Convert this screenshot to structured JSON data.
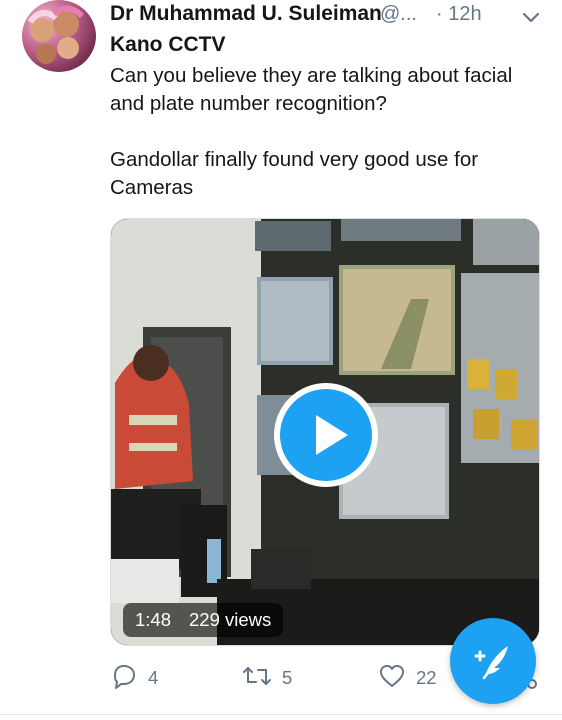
{
  "author": {
    "display_name": "Dr Muhammad U. Suleiman",
    "handle": "@...",
    "timestamp": "· 12h"
  },
  "tweet": {
    "title": "Kano CCTV",
    "lines": [
      "Can you believe they are talking about facial",
      "and plate number recognition?",
      "",
      "Gandollar finally found very good use for",
      "Cameras"
    ]
  },
  "video": {
    "duration": "1:48",
    "views": "229 views",
    "play_icon": "play-icon"
  },
  "actions": {
    "reply_count": "4",
    "retweet_count": "5",
    "like_count": "22"
  },
  "icons": {
    "reply": "reply-icon",
    "retweet": "retweet-icon",
    "like": "heart-icon",
    "share": "share-icon",
    "compose": "compose-tweet-icon",
    "menu": "chevron-down-icon"
  },
  "colors": {
    "accent": "#1da1f2",
    "text": "#14171a",
    "secondary_text": "#657786"
  }
}
